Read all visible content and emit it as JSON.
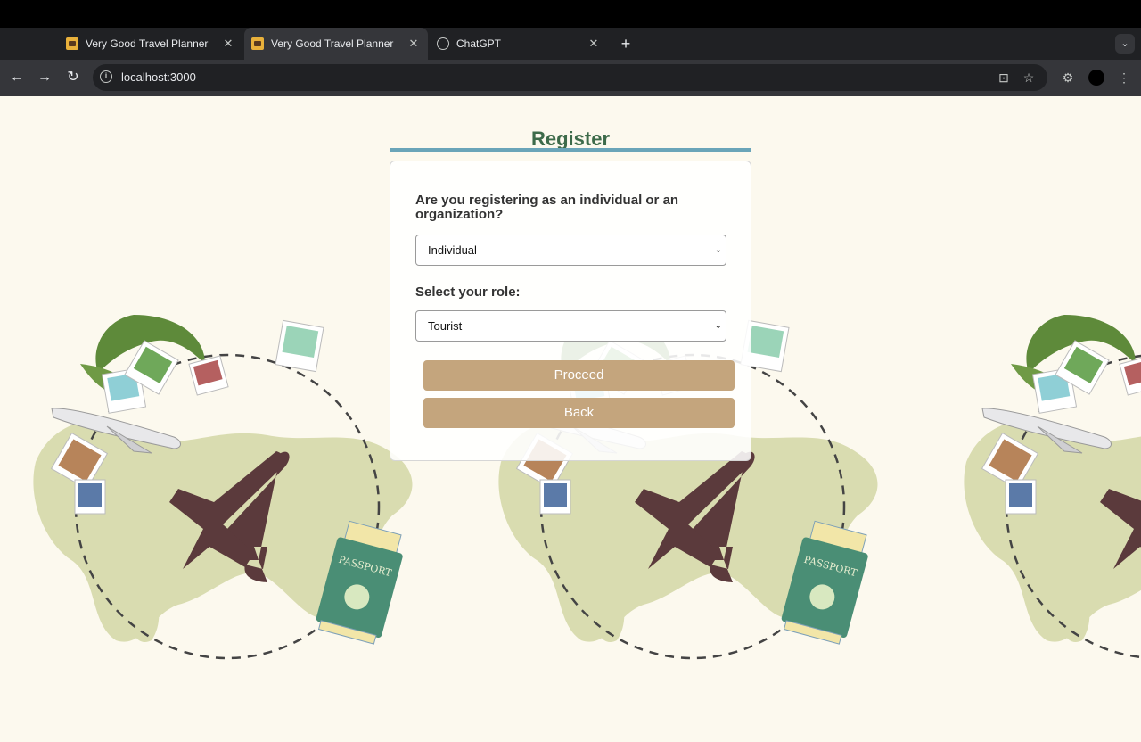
{
  "browser": {
    "tabs": [
      {
        "title": "Very Good Travel Planner",
        "icon": "travel-planner-favicon",
        "active": false
      },
      {
        "title": "Very Good Travel Planner",
        "icon": "travel-planner-favicon",
        "active": true
      },
      {
        "title": "ChatGPT",
        "icon": "chatgpt-favicon",
        "active": false
      }
    ],
    "close_glyph": "✕",
    "new_tab_glyph": "+",
    "url": "localhost:3000"
  },
  "page": {
    "title": "Register",
    "question": "Are you registering as an individual or an organization?",
    "entity_type": {
      "selected": "Individual"
    },
    "role_label": "Select your role:",
    "role": {
      "selected": "Tourist"
    },
    "proceed_label": "Proceed",
    "back_label": "Back"
  },
  "colors": {
    "page_background": "#fcf9ee",
    "title": "#3d6b4a",
    "title_rule": "#6aa5b9",
    "button": "#c4a57d"
  }
}
